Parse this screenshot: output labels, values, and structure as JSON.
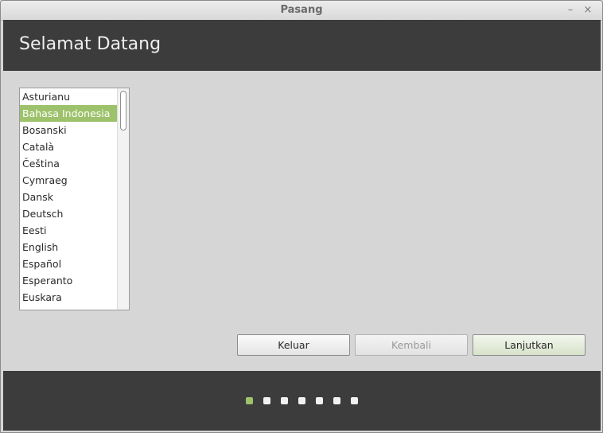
{
  "window": {
    "title": "Pasang",
    "minimize_glyph": "–",
    "close_glyph": "×"
  },
  "header": {
    "title": "Selamat Datang"
  },
  "language_list": {
    "items": [
      "Asturianu",
      "Bahasa Indonesia",
      "Bosanski",
      "Català",
      "Čeština",
      "Cymraeg",
      "Dansk",
      "Deutsch",
      "Eesti",
      "English",
      "Español",
      "Esperanto",
      "Euskara"
    ],
    "selected": "Bahasa Indonesia"
  },
  "buttons": {
    "quit": "Keluar",
    "back": "Kembali",
    "next": "Lanjutkan"
  },
  "progress": {
    "total_steps": 7,
    "current_step": 1
  },
  "colors": {
    "accent": "#9dc26b",
    "header_bg": "#3c3c3c",
    "window_bg": "#d6d6d6"
  }
}
